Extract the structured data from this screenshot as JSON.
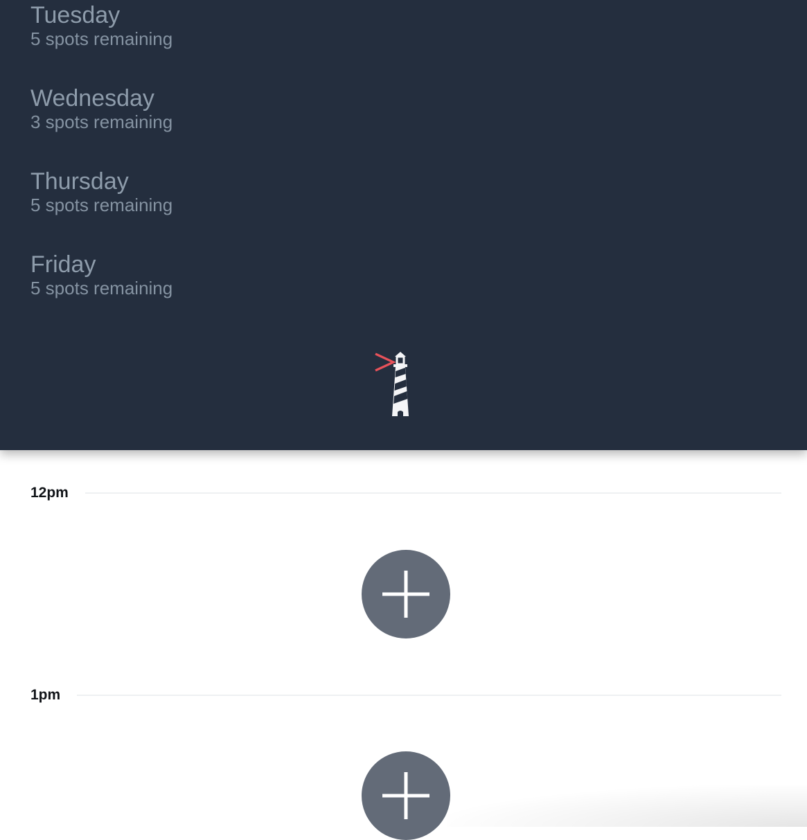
{
  "days": [
    {
      "name": "Tuesday",
      "spots": "5 spots remaining"
    },
    {
      "name": "Wednesday",
      "spots": "3 spots remaining"
    },
    {
      "name": "Thursday",
      "spots": "5 spots remaining"
    },
    {
      "name": "Friday",
      "spots": "5 spots remaining"
    }
  ],
  "logo": {
    "icon": "lighthouse-icon",
    "accent_color": "#e8525a"
  },
  "timeline": {
    "hours": [
      {
        "label": "12pm",
        "add_icon": "plus-icon"
      },
      {
        "label": "1pm",
        "add_icon": "plus-icon"
      }
    ]
  },
  "colors": {
    "panel_background": "#242e3e",
    "day_text": "#8e9cab",
    "add_button": "#636b78"
  }
}
